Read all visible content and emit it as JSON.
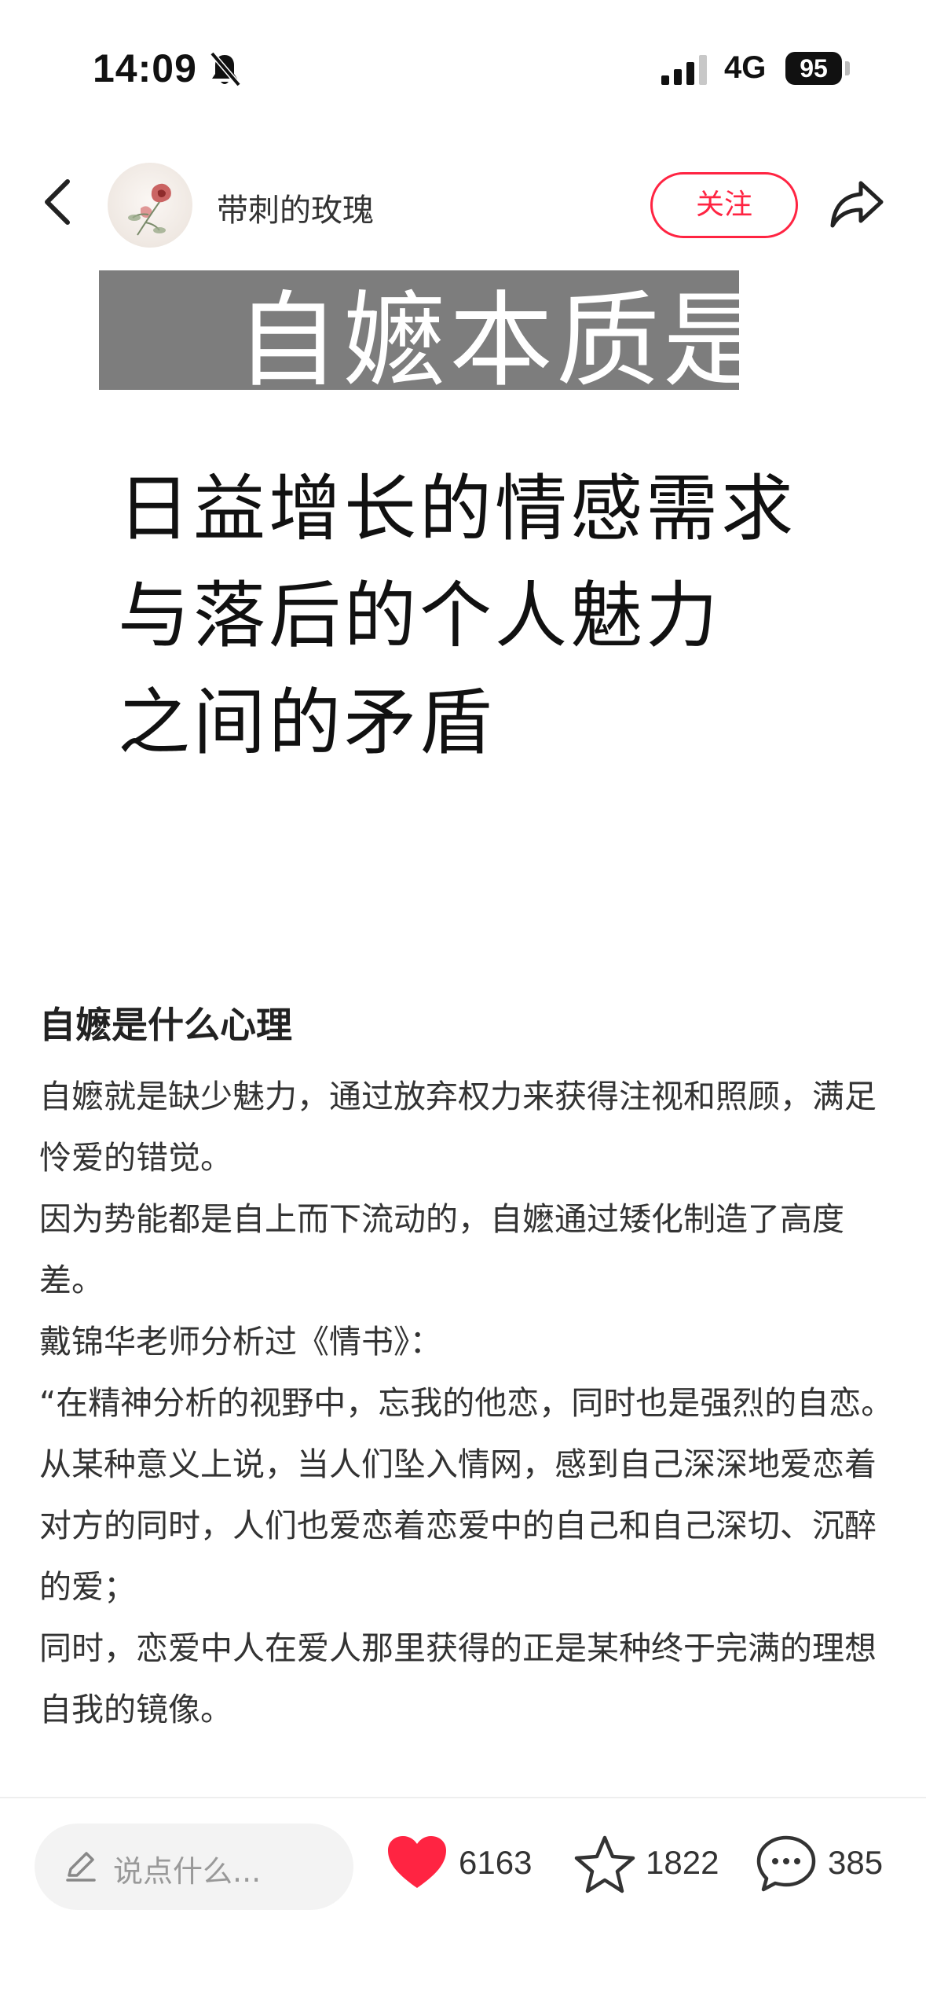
{
  "status_bar": {
    "time": "14:09",
    "network": "4G",
    "battery": "95"
  },
  "header": {
    "author_name": "带刺的玫瑰",
    "follow_label": "关注"
  },
  "image": {
    "title": "自嬷本质是",
    "lines": [
      "日益增长的情感需求",
      "与落后的个人魅力",
      "之间的矛盾"
    ]
  },
  "article": {
    "title": "自嬷是什么心理",
    "paragraphs": [
      "自嬷就是缺少魅力，通过放弃权力来获得注视和照顾，满足怜爱的错觉。",
      "因为势能都是自上而下流动的，自嬷通过矮化制造了高度差。",
      "戴锦华老师分析过《情书》：",
      "“在精神分析的视野中，忘我的他恋，同时也是强烈的自恋。",
      "从某种意义上说，当人们坠入情网，感到自己深深地爱恋着对方的同时，人们也爱恋着恋爱中的自己和自己深切、沉醉的爱；",
      "同时，恋爱中人在爱人那里获得的正是某种终于完满的理想自我的镜像。"
    ]
  },
  "bottom_bar": {
    "comment_placeholder": "说点什么...",
    "likes": "6163",
    "collects": "1822",
    "comments": "385"
  },
  "colors": {
    "accent": "#ff2442",
    "like_red": "#ff2442"
  },
  "icons": [
    "bell-off-icon",
    "signal-icon",
    "back-icon",
    "share-icon",
    "pencil-icon",
    "heart-icon",
    "star-icon",
    "comment-bubble-icon"
  ]
}
